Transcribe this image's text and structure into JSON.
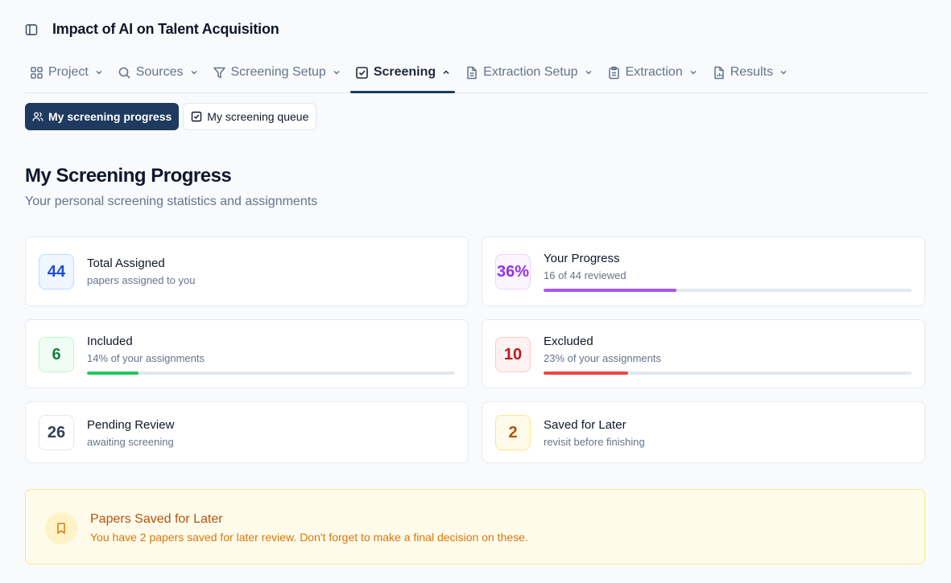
{
  "header": {
    "title": "Impact of AI on Talent Acquisition"
  },
  "nav": {
    "tabs": [
      {
        "label": "Project",
        "icon": "grid-icon",
        "active": false
      },
      {
        "label": "Sources",
        "icon": "search-icon",
        "active": false
      },
      {
        "label": "Screening Setup",
        "icon": "filter-icon",
        "active": false
      },
      {
        "label": "Screening",
        "icon": "check-square-icon",
        "active": true
      },
      {
        "label": "Extraction Setup",
        "icon": "document-icon",
        "active": false
      },
      {
        "label": "Extraction",
        "icon": "clipboard-icon",
        "active": false
      },
      {
        "label": "Results",
        "icon": "chart-file-icon",
        "active": false
      }
    ]
  },
  "subtabs": {
    "progress": "My screening progress",
    "queue": "My screening queue"
  },
  "page": {
    "title": "My Screening Progress",
    "subtitle": "Your personal screening statistics and assignments"
  },
  "stats": {
    "total": {
      "value": "44",
      "title": "Total Assigned",
      "sub": "papers assigned to you"
    },
    "progress": {
      "value": "36%",
      "title": "Your Progress",
      "sub": "16 of 44 reviewed",
      "fraction": 0.36
    },
    "included": {
      "value": "6",
      "title": "Included",
      "sub": "14% of your assignments",
      "fraction": 0.14
    },
    "excluded": {
      "value": "10",
      "title": "Excluded",
      "sub": "23% of your assignments",
      "fraction": 0.23
    },
    "pending": {
      "value": "26",
      "title": "Pending Review",
      "sub": "awaiting screening"
    },
    "saved": {
      "value": "2",
      "title": "Saved for Later",
      "sub": "revisit before finishing"
    }
  },
  "colors": {
    "accent": "#1e3a5f",
    "progress": "#a855f7",
    "included": "#22c55e",
    "excluded": "#ef4444"
  },
  "alert": {
    "title": "Papers Saved for Later",
    "text": "You have 2 papers saved for later review. Don't forget to make a final decision on these."
  }
}
